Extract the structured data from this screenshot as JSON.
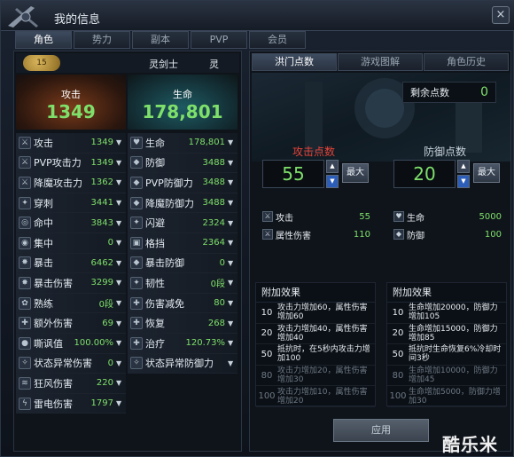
{
  "window": {
    "title": "我的信息",
    "close": "×"
  },
  "tabs": [
    "角色",
    "势力",
    "副本",
    "PVP",
    "会员"
  ],
  "header": {
    "badge": "15",
    "class1": "灵剑士",
    "class2": "灵"
  },
  "summary": {
    "atk_label": "攻击",
    "atk_value": "1349",
    "hp_label": "生命",
    "hp_value": "178,801"
  },
  "left_stats": [
    {
      "name": "攻击",
      "value": "1349"
    },
    {
      "name": "PVP攻击力",
      "value": "1349"
    },
    {
      "name": "降魔攻击力",
      "value": "1362"
    },
    {
      "name": "穿刺",
      "value": "3441"
    },
    {
      "name": "命中",
      "value": "3843"
    },
    {
      "name": "集中",
      "value": "0"
    },
    {
      "name": "暴击",
      "value": "6462"
    },
    {
      "name": "暴击伤害",
      "value": "3299"
    },
    {
      "name": "熟练",
      "value": "0段"
    },
    {
      "name": "额外伤害",
      "value": "69"
    },
    {
      "name": "嘶讽值",
      "value": "100.00%"
    },
    {
      "name": "状态异常伤害",
      "value": "0"
    },
    {
      "name": "狂风伤害",
      "value": "220"
    },
    {
      "name": "雷电伤害",
      "value": "1797"
    }
  ],
  "right_stats": [
    {
      "name": "生命",
      "value": "178,801"
    },
    {
      "name": "防御",
      "value": "3488"
    },
    {
      "name": "PVP防御力",
      "value": "3488"
    },
    {
      "name": "降魔防御力",
      "value": "3488"
    },
    {
      "name": "闪避",
      "value": "2324"
    },
    {
      "name": "格挡",
      "value": "2364"
    },
    {
      "name": "暴击防御",
      "value": "0"
    },
    {
      "name": "韧性",
      "value": "0段"
    },
    {
      "name": "伤害减免",
      "value": "80"
    },
    {
      "name": "恢复",
      "value": "268"
    },
    {
      "name": "治疗",
      "value": "120.73%"
    },
    {
      "name": "状态异常防御力",
      "value": ""
    }
  ],
  "rtabs": [
    "洪门点数",
    "游戏图解",
    "角色历史"
  ],
  "remain": {
    "label": "剩余点数",
    "value": "0"
  },
  "attack": {
    "title": "攻击点数",
    "points": "55",
    "max": "最大",
    "stats": [
      {
        "name": "攻击",
        "value": "55"
      },
      {
        "name": "属性伤害",
        "value": "110"
      }
    ],
    "bonus_title": "附加效果",
    "bonus": [
      {
        "lv": "10",
        "text": "攻击力增加60，属性伤害增加60"
      },
      {
        "lv": "20",
        "text": "攻击力增加40，属性伤害增加40"
      },
      {
        "lv": "50",
        "text": "抵抗时，在5秒内攻击力增加100"
      },
      {
        "lv": "80",
        "text": "攻击力增加20，属性伤害增加30"
      },
      {
        "lv": "100",
        "text": "攻击力增加10，属性伤害增加20"
      }
    ]
  },
  "defense": {
    "title": "防御点数",
    "points": "20",
    "max": "最大",
    "stats": [
      {
        "name": "生命",
        "value": "5000"
      },
      {
        "name": "防御",
        "value": "100"
      }
    ],
    "bonus_title": "附加效果",
    "bonus": [
      {
        "lv": "10",
        "text": "生命增加20000，防御力增加105"
      },
      {
        "lv": "20",
        "text": "生命增加15000，防御力增加85"
      },
      {
        "lv": "50",
        "text": "抵抗时生命恢复6%冷却时间3秒"
      },
      {
        "lv": "80",
        "text": "生命增加10000，防御力增加45"
      },
      {
        "lv": "100",
        "text": "生命增加5000，防御力增加30"
      }
    ]
  },
  "apply": "应用",
  "watermark": "酷乐米"
}
